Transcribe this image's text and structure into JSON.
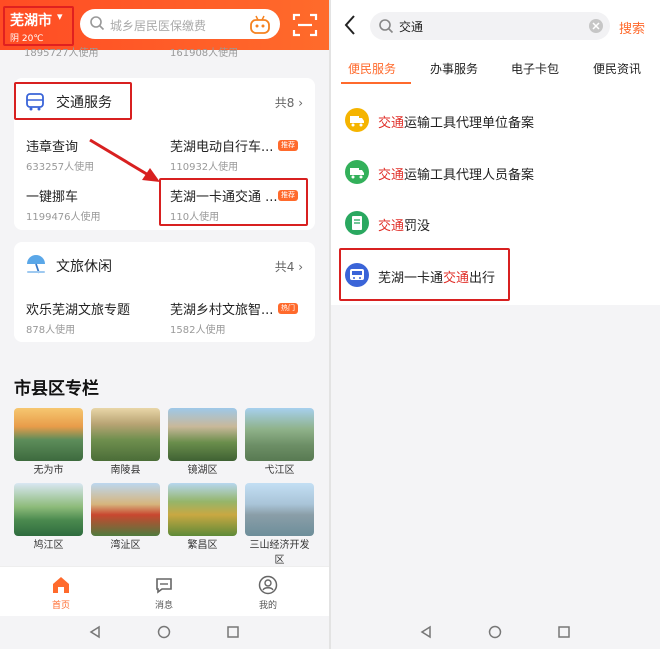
{
  "left": {
    "header": {
      "city": "芜湖市",
      "weather": "阴 20℃",
      "search_placeholder": "城乡居民医保缴费"
    },
    "top_stats": [
      "1895727人使用",
      "161908人使用"
    ],
    "transport_card": {
      "title": "交通服务",
      "count": "共8",
      "items": [
        {
          "name": "违章查询",
          "users": "633257人使用"
        },
        {
          "name": "芜湖电动自行车...",
          "users": "110932人使用",
          "tag": "推荐"
        },
        {
          "name": "一键挪车",
          "users": "1199476人使用"
        },
        {
          "name": "芜湖一卡通交通 ...",
          "users": "110人使用",
          "tag": "推荐"
        }
      ]
    },
    "culture_card": {
      "title": "文旅休闲",
      "count": "共4",
      "items": [
        {
          "name": "欢乐芜湖文旅专题",
          "users": "878人使用"
        },
        {
          "name": "芜湖乡村文旅智...",
          "users": "1582人使用",
          "tag": "热门"
        }
      ]
    },
    "district_section": {
      "title": "市县区专栏",
      "items": [
        "无为市",
        "南陵县",
        "镜湖区",
        "弋江区",
        "鸠江区",
        "湾沚区",
        "繁昌区",
        "三山经济开发区"
      ]
    },
    "nav": [
      {
        "label": "首页",
        "active": true
      },
      {
        "label": "消息",
        "active": false
      },
      {
        "label": "我的",
        "active": false
      }
    ]
  },
  "right": {
    "search": {
      "value": "交通",
      "button": "搜索"
    },
    "tabs": [
      "便民服务",
      "办事服务",
      "电子卡包",
      "便民资讯"
    ],
    "results": [
      {
        "prefix": "",
        "highlight": "交通",
        "suffix": "运输工具代理单位备案",
        "icon_color": "#f5b400"
      },
      {
        "prefix": "",
        "highlight": "交通",
        "suffix": "运输工具代理人员备案",
        "icon_color": "#33b05a"
      },
      {
        "prefix": "",
        "highlight": "交通",
        "suffix": "罚没",
        "icon_color": "#2aa860"
      },
      {
        "prefix": "芜湖一卡通",
        "highlight": "交通",
        "suffix": "出行",
        "icon_color": "#3a64d8"
      }
    ]
  },
  "colors": {
    "accent": "#ff6a2c",
    "highlight": "#e0302a",
    "annotation": "#d82020"
  }
}
